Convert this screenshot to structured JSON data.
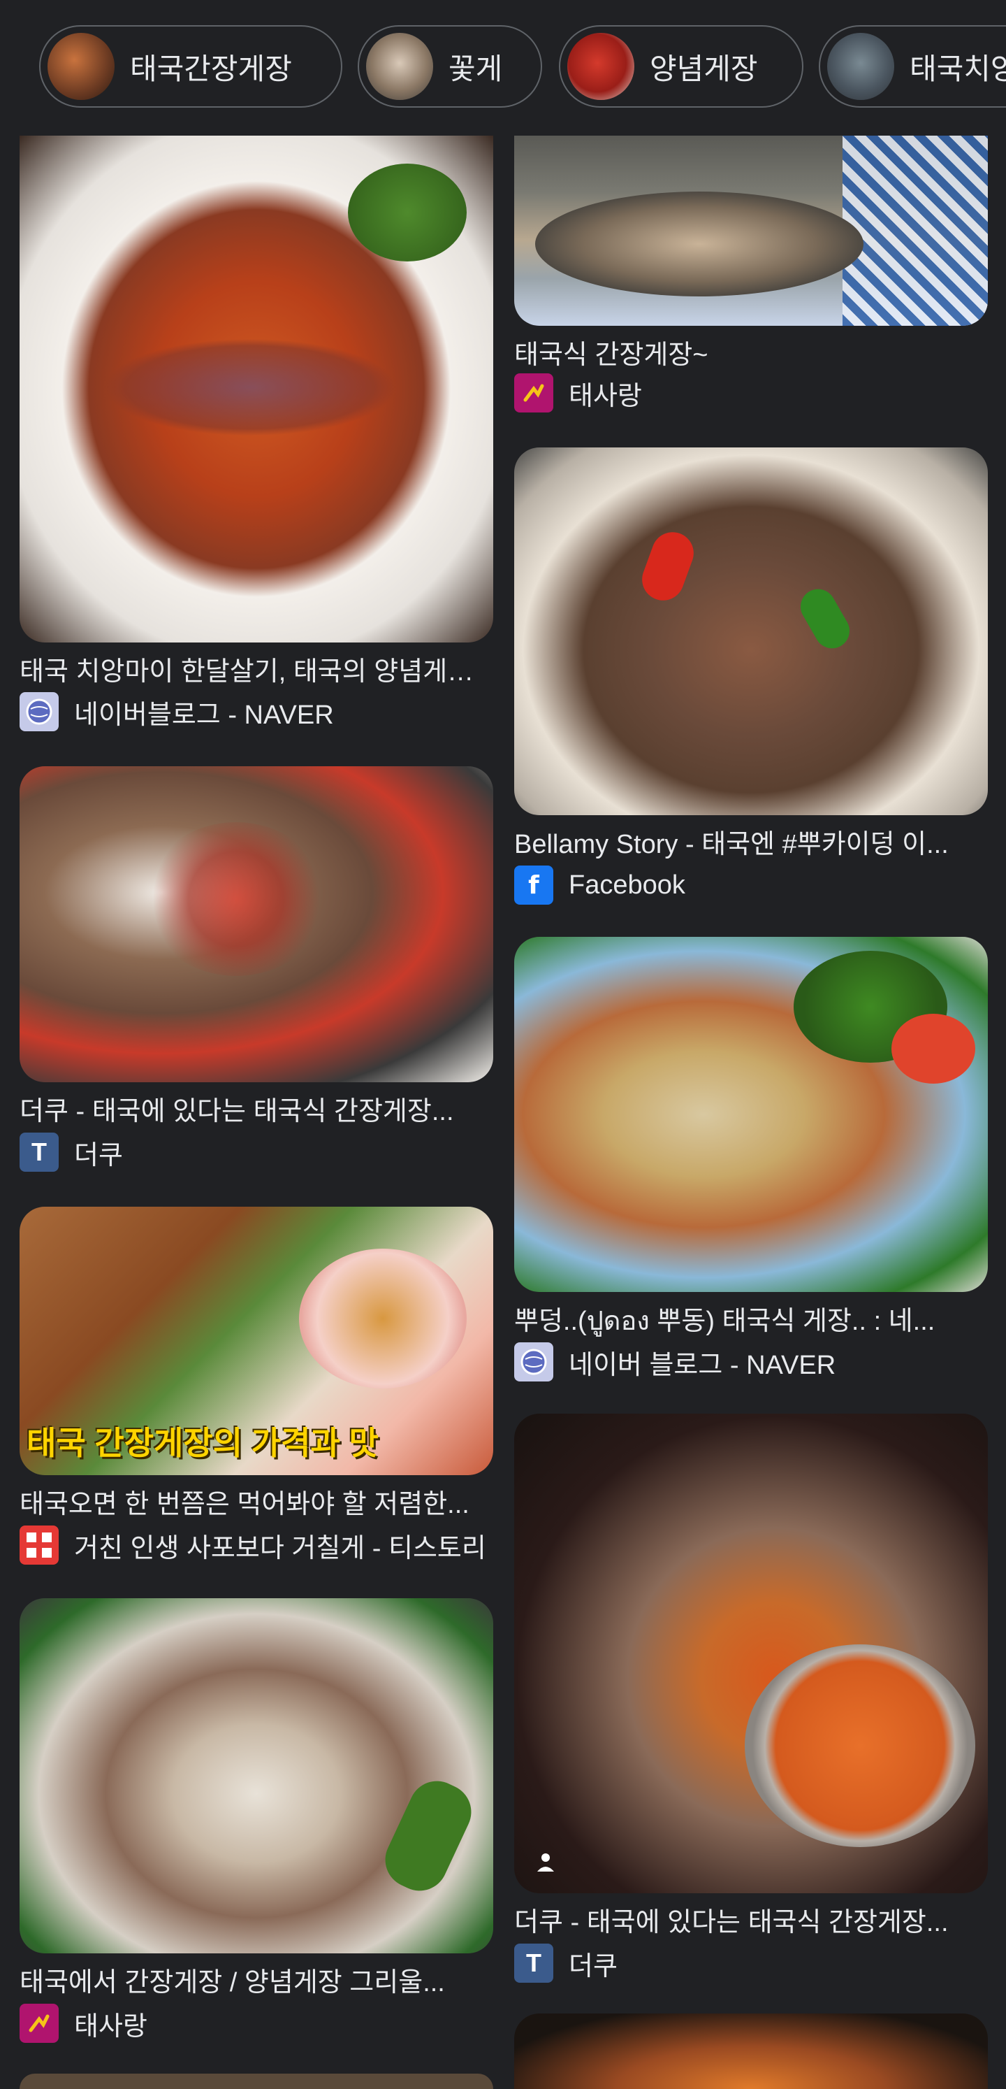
{
  "chips": [
    {
      "label": "태국간장게장"
    },
    {
      "label": "꽃게"
    },
    {
      "label": "양념게장"
    },
    {
      "label": "태국치앙"
    }
  ],
  "results": [
    {
      "caption": "태국 치앙마이 한달살기, 태국의 양념게장...",
      "source": "네이버블로그 - NAVER",
      "favicon": "globe-icon"
    },
    {
      "caption": "태국식 간장게장~",
      "source": "태사랑",
      "favicon": "tsarang-icon"
    },
    {
      "caption": "Bellamy Story - 태국엔 #뿌카이덩 이...",
      "source": "Facebook",
      "favicon": "facebook-icon"
    },
    {
      "caption": "더쿠 - 태국에 있다는 태국식 간장게장...",
      "source": "더쿠",
      "favicon": "theqoo-icon"
    },
    {
      "caption": "뿌덩..(ปูดอง 뿌동) 태국식 게장.. : 네...",
      "source": "네이버 블로그 - NAVER",
      "favicon": "globe-icon"
    },
    {
      "caption": "태국오면 한 번쯤은 먹어봐야 할 저렴한...",
      "source": "거친 인생 사포보다 거칠게 - 티스토리",
      "favicon": "tistory-icon",
      "overlay": "태국 간장게장의 가격과 맛"
    },
    {
      "caption": "더쿠 - 태국에 있다는 태국식 간장게장...",
      "source": "더쿠",
      "favicon": "theqoo-icon"
    },
    {
      "caption": "태국에서 간장게장 / 양념게장 그리울...",
      "source": "태사랑",
      "favicon": "tsarang-icon"
    }
  ],
  "favicon_letters": {
    "facebook": "f",
    "theqoo": "T"
  },
  "colors": {
    "background": "#202124",
    "chip_border": "#5f6368",
    "text": "#e8eaed",
    "facebook": "#1877f2",
    "theqoo": "#3b5b8c",
    "tsarang": "#b0146e"
  }
}
